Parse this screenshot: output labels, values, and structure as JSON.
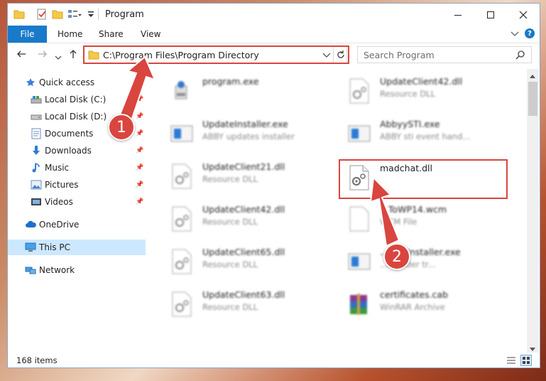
{
  "window": {
    "title": "Program"
  },
  "ribbon": {
    "file": "File",
    "tabs": [
      "Home",
      "Share",
      "View"
    ]
  },
  "address": {
    "path": "C:\\Program Files\\Program Directory"
  },
  "search": {
    "placeholder": "Search Program"
  },
  "sidebar": {
    "items": [
      {
        "label": "Quick access",
        "icon": "star-icon"
      },
      {
        "label": "Local Disk (C:)",
        "icon": "drive-icon",
        "pinned": true
      },
      {
        "label": "Local Disk (D:)",
        "icon": "drive-icon",
        "pinned": true
      },
      {
        "label": "Documents",
        "icon": "documents-icon",
        "pinned": true
      },
      {
        "label": "Downloads",
        "icon": "download-icon",
        "pinned": true
      },
      {
        "label": "Music",
        "icon": "music-icon",
        "pinned": true
      },
      {
        "label": "Pictures",
        "icon": "pictures-icon",
        "pinned": true
      },
      {
        "label": "Videos",
        "icon": "videos-icon",
        "pinned": true
      },
      {
        "label": "OneDrive",
        "icon": "cloud-icon"
      },
      {
        "label": "This PC",
        "icon": "pc-icon",
        "selected": true
      },
      {
        "label": "Network",
        "icon": "network-icon"
      }
    ]
  },
  "files": [
    {
      "name": "program.exe",
      "desc": "",
      "icon": "exe-icon"
    },
    {
      "name": "UpdateClient42.dll",
      "desc": "Resource DLL",
      "icon": "dll-icon"
    },
    {
      "name": "UpdateInstaller.exe",
      "desc": "ABBY updates installer",
      "icon": "app-icon"
    },
    {
      "name": "AbbyySTI.exe",
      "desc": "ABBY sti event hand...",
      "icon": "app-icon"
    },
    {
      "name": "UpdateClient21.dll",
      "desc": "Resource DLL",
      "icon": "dll-icon"
    },
    {
      "name": "madchat.dll",
      "desc": "",
      "icon": "dll-icon"
    },
    {
      "name": "UpdateClient42.dll",
      "desc": "Resource DLL",
      "icon": "dll-icon"
    },
    {
      "name": "...ToWP14.wcm",
      "desc": "WCM File",
      "icon": "file-icon"
    },
    {
      "name": "UpdateClient65.dll",
      "desc": "Resource DLL",
      "icon": "dll-icon"
    },
    {
      "name": "...omsInstaller.exe",
      "desc": "...ereader tr...",
      "icon": "app-icon"
    },
    {
      "name": "UpdateClient63.dll",
      "desc": "Resource DLL",
      "icon": "dll-icon"
    },
    {
      "name": "certificates.cab",
      "desc": "WinRAR Archive",
      "icon": "archive-icon"
    }
  ],
  "status": {
    "count": "168 items"
  },
  "callouts": {
    "one": "1",
    "two": "2"
  },
  "colors": {
    "accent": "#1979ca",
    "highlight": "#d9453f",
    "selected": "#cce8ff"
  }
}
